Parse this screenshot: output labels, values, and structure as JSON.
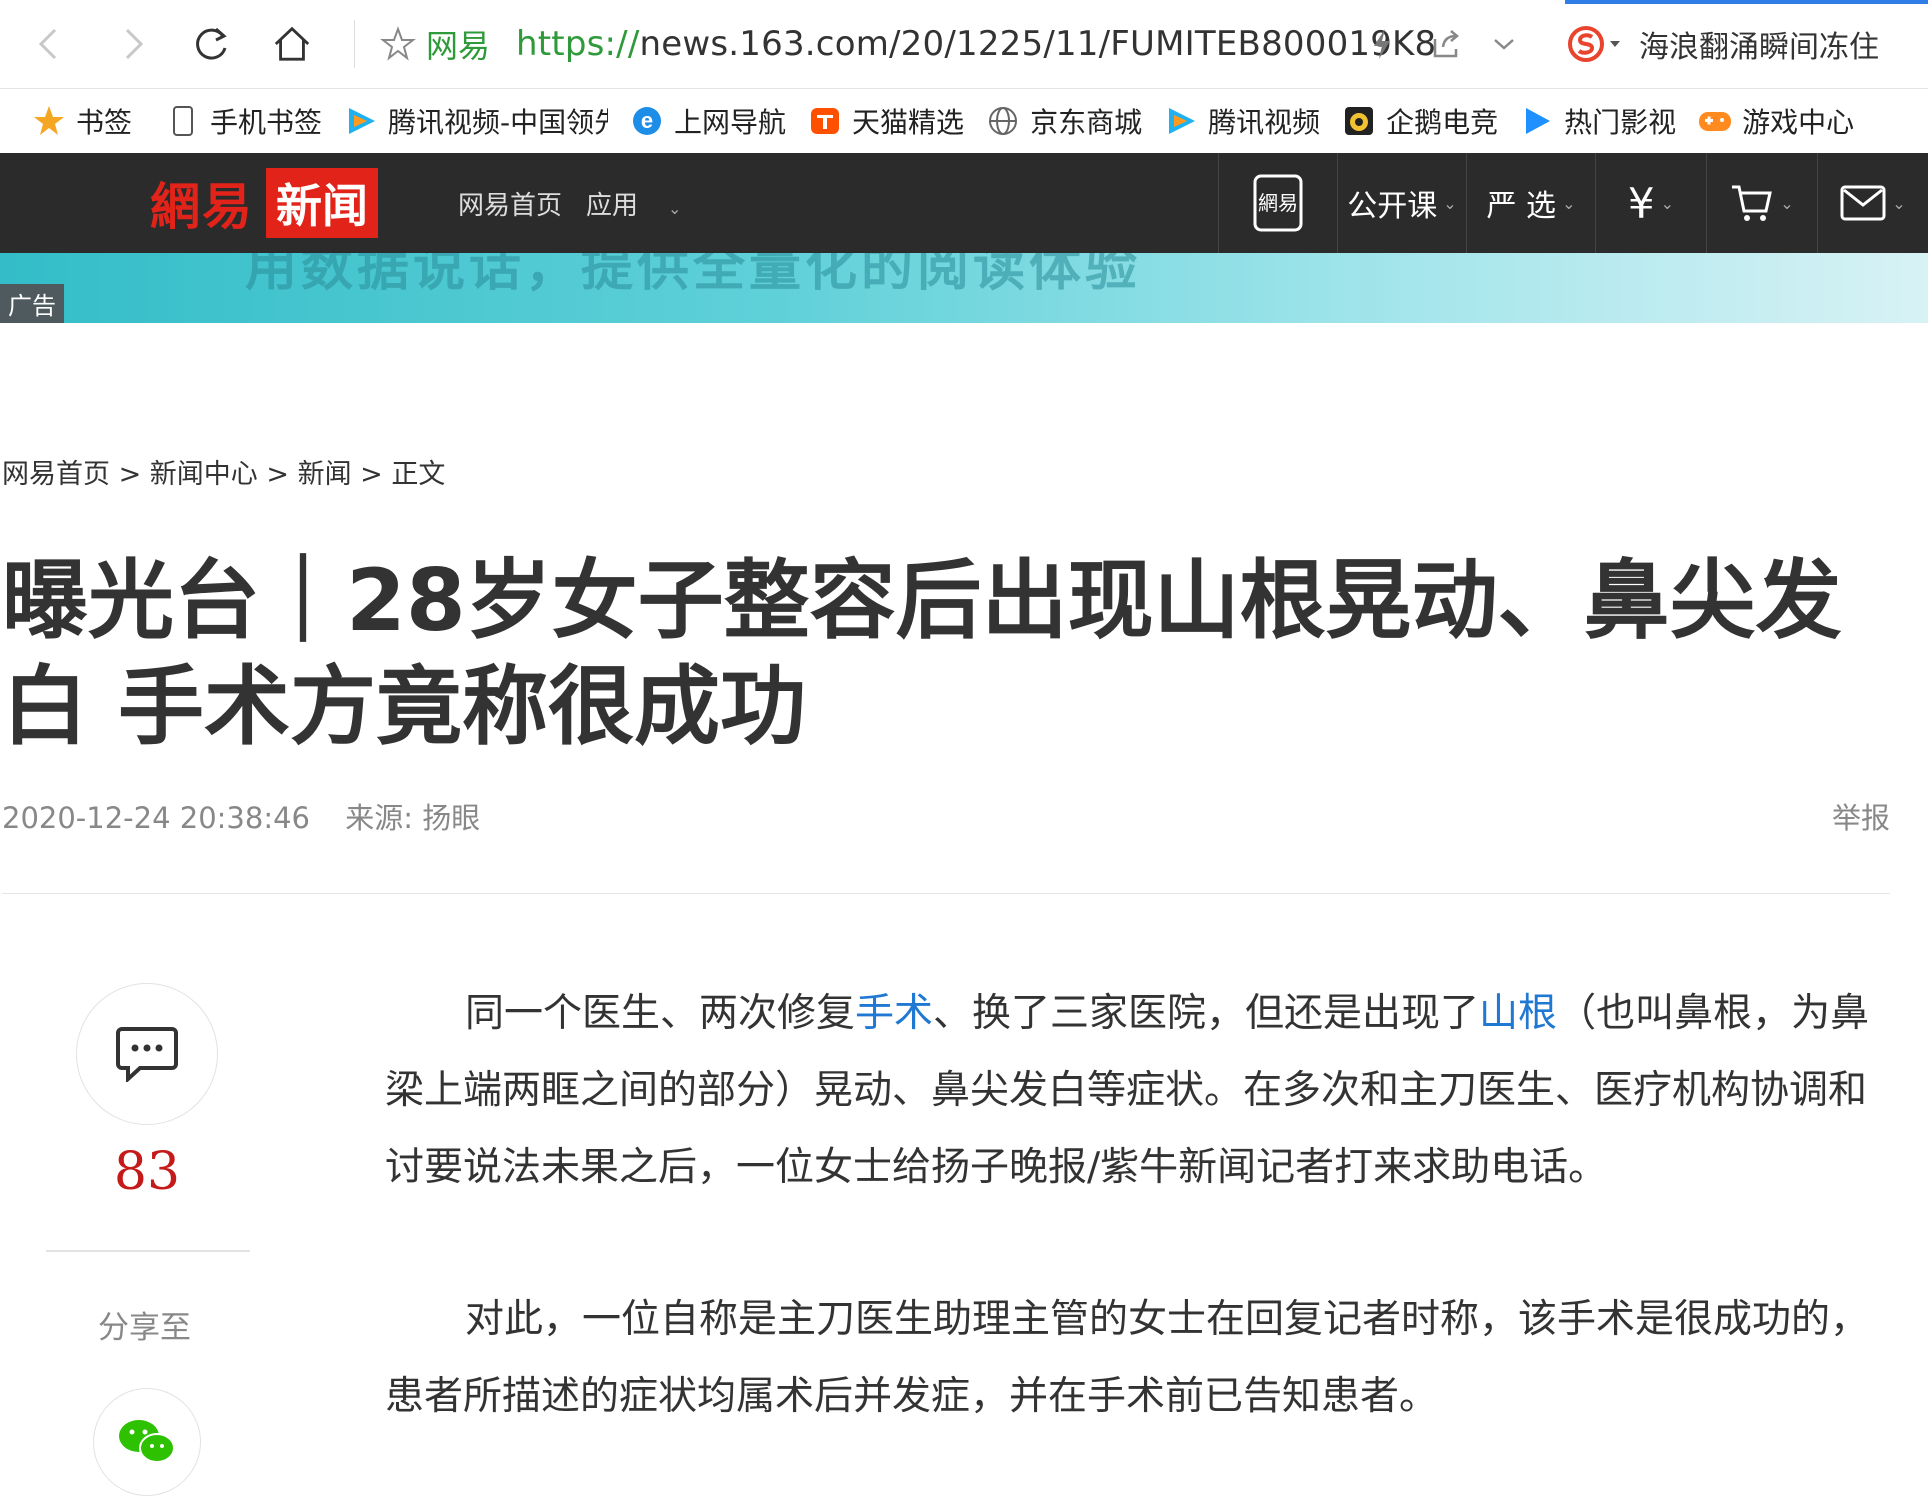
{
  "browser": {
    "site_label": "网易",
    "url_protocol": "https://",
    "url_rest": "news.163.com/20/1225/11/FUMITEB800019K8",
    "hot_search": "海浪翻涌瞬间冻住"
  },
  "bookmarks": [
    {
      "label": "书签",
      "icon": "star-icon"
    },
    {
      "label": "手机书签",
      "icon": "phone-icon"
    },
    {
      "label": "腾讯视频-中国领先",
      "icon": "tencent-video-icon"
    },
    {
      "label": "上网导航",
      "icon": "ie-icon"
    },
    {
      "label": "天猫精选",
      "icon": "tmall-icon"
    },
    {
      "label": "京东商城",
      "icon": "globe-icon"
    },
    {
      "label": "腾讯视频",
      "icon": "tencent-video-icon"
    },
    {
      "label": "企鹅电竞",
      "icon": "penguin-esports-icon"
    },
    {
      "label": "热门影视",
      "icon": "play-icon"
    },
    {
      "label": "游戏中心",
      "icon": "gamepad-icon"
    }
  ],
  "nav": {
    "logo_text": "網易",
    "logo_badge": "新闻",
    "home_link": "网易首页",
    "apps_link": "应用",
    "mobile_label": "網易",
    "open_course": "公开课",
    "yanxuan": "严 选",
    "money_symbol": "¥"
  },
  "banner": {
    "text": "用数据说话，提供全量化的阅读体验",
    "ad_label": "广告"
  },
  "breadcrumb": "网易首页 > 新闻中心 > 新闻 > 正文",
  "article": {
    "title": "曝光台｜28岁女子整容后出现山根晃动、鼻尖发白 手术方竟称很成功",
    "datetime": "2020-12-24 20:38:46",
    "source": "来源: 扬眼",
    "report": "举报",
    "p1_a": "同一个医生、两次修复",
    "p1_link1": "手术",
    "p1_b": "、换了三家医院，但还是出现了",
    "p1_link2": "山根",
    "p1_c": "（也叫鼻根，为鼻梁上端两眶之间的部分）晃动、鼻尖发白等症状。在多次和主刀医生、医疗机构协调和讨要说法未果之后，一位女士给扬子晚报/紫牛新闻记者打来求助电话。",
    "p2": "对此，一位自称是主刀医生助理主管的女士在回复记者时称，该手术是很成功的，患者所描述的症状均属术后并发症，并在手术前已告知患者。"
  },
  "sidebar": {
    "comment_count": "83",
    "share_label": "分享至"
  },
  "colors": {
    "brand_red": "#e2231a",
    "link_blue": "#1f78d1",
    "url_green": "#2e9a3a",
    "nav_dark": "#2b2b2b"
  }
}
